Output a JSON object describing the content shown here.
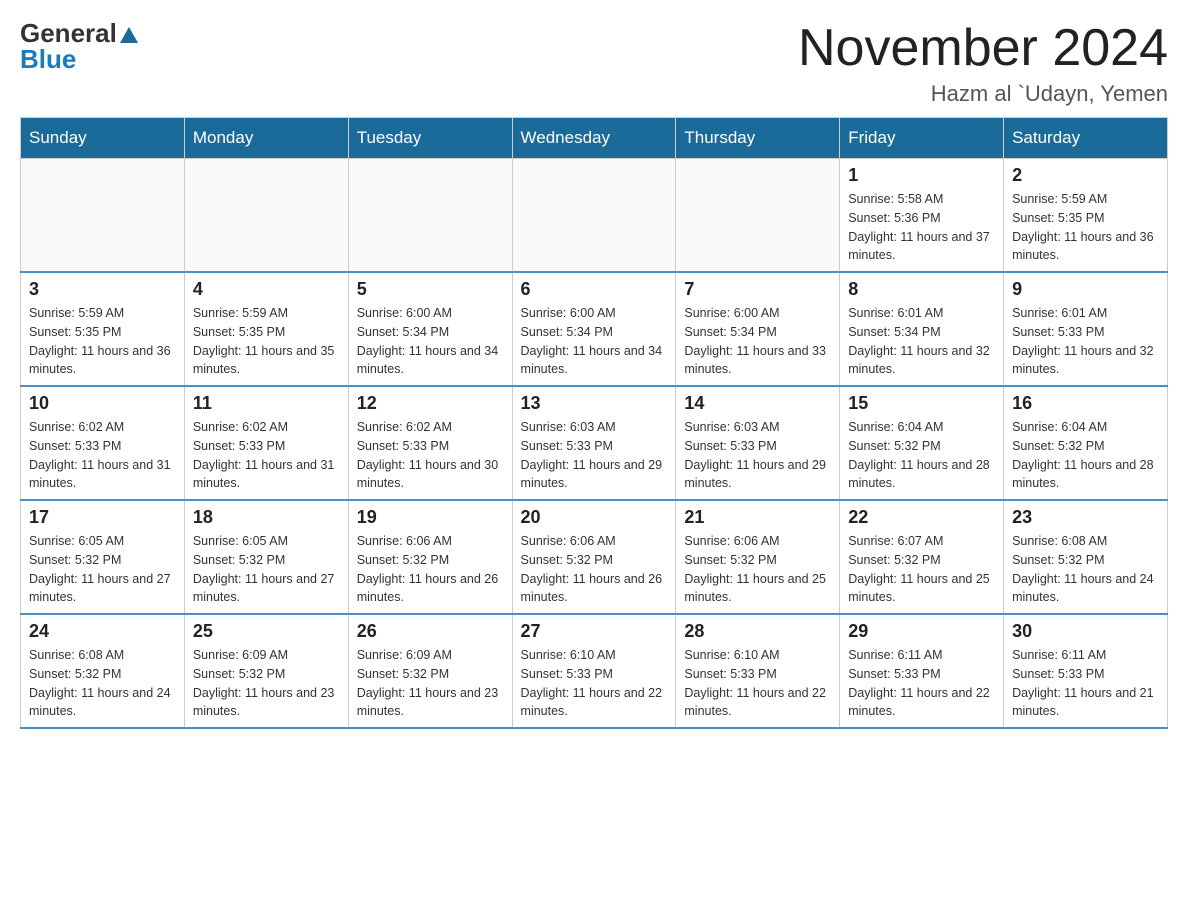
{
  "logo": {
    "general": "General",
    "blue": "Blue"
  },
  "title": "November 2024",
  "location": "Hazm al `Udayn, Yemen",
  "days_of_week": [
    "Sunday",
    "Monday",
    "Tuesday",
    "Wednesday",
    "Thursday",
    "Friday",
    "Saturday"
  ],
  "weeks": [
    [
      {
        "day": "",
        "info": ""
      },
      {
        "day": "",
        "info": ""
      },
      {
        "day": "",
        "info": ""
      },
      {
        "day": "",
        "info": ""
      },
      {
        "day": "",
        "info": ""
      },
      {
        "day": "1",
        "info": "Sunrise: 5:58 AM\nSunset: 5:36 PM\nDaylight: 11 hours and 37 minutes."
      },
      {
        "day": "2",
        "info": "Sunrise: 5:59 AM\nSunset: 5:35 PM\nDaylight: 11 hours and 36 minutes."
      }
    ],
    [
      {
        "day": "3",
        "info": "Sunrise: 5:59 AM\nSunset: 5:35 PM\nDaylight: 11 hours and 36 minutes."
      },
      {
        "day": "4",
        "info": "Sunrise: 5:59 AM\nSunset: 5:35 PM\nDaylight: 11 hours and 35 minutes."
      },
      {
        "day": "5",
        "info": "Sunrise: 6:00 AM\nSunset: 5:34 PM\nDaylight: 11 hours and 34 minutes."
      },
      {
        "day": "6",
        "info": "Sunrise: 6:00 AM\nSunset: 5:34 PM\nDaylight: 11 hours and 34 minutes."
      },
      {
        "day": "7",
        "info": "Sunrise: 6:00 AM\nSunset: 5:34 PM\nDaylight: 11 hours and 33 minutes."
      },
      {
        "day": "8",
        "info": "Sunrise: 6:01 AM\nSunset: 5:34 PM\nDaylight: 11 hours and 32 minutes."
      },
      {
        "day": "9",
        "info": "Sunrise: 6:01 AM\nSunset: 5:33 PM\nDaylight: 11 hours and 32 minutes."
      }
    ],
    [
      {
        "day": "10",
        "info": "Sunrise: 6:02 AM\nSunset: 5:33 PM\nDaylight: 11 hours and 31 minutes."
      },
      {
        "day": "11",
        "info": "Sunrise: 6:02 AM\nSunset: 5:33 PM\nDaylight: 11 hours and 31 minutes."
      },
      {
        "day": "12",
        "info": "Sunrise: 6:02 AM\nSunset: 5:33 PM\nDaylight: 11 hours and 30 minutes."
      },
      {
        "day": "13",
        "info": "Sunrise: 6:03 AM\nSunset: 5:33 PM\nDaylight: 11 hours and 29 minutes."
      },
      {
        "day": "14",
        "info": "Sunrise: 6:03 AM\nSunset: 5:33 PM\nDaylight: 11 hours and 29 minutes."
      },
      {
        "day": "15",
        "info": "Sunrise: 6:04 AM\nSunset: 5:32 PM\nDaylight: 11 hours and 28 minutes."
      },
      {
        "day": "16",
        "info": "Sunrise: 6:04 AM\nSunset: 5:32 PM\nDaylight: 11 hours and 28 minutes."
      }
    ],
    [
      {
        "day": "17",
        "info": "Sunrise: 6:05 AM\nSunset: 5:32 PM\nDaylight: 11 hours and 27 minutes."
      },
      {
        "day": "18",
        "info": "Sunrise: 6:05 AM\nSunset: 5:32 PM\nDaylight: 11 hours and 27 minutes."
      },
      {
        "day": "19",
        "info": "Sunrise: 6:06 AM\nSunset: 5:32 PM\nDaylight: 11 hours and 26 minutes."
      },
      {
        "day": "20",
        "info": "Sunrise: 6:06 AM\nSunset: 5:32 PM\nDaylight: 11 hours and 26 minutes."
      },
      {
        "day": "21",
        "info": "Sunrise: 6:06 AM\nSunset: 5:32 PM\nDaylight: 11 hours and 25 minutes."
      },
      {
        "day": "22",
        "info": "Sunrise: 6:07 AM\nSunset: 5:32 PM\nDaylight: 11 hours and 25 minutes."
      },
      {
        "day": "23",
        "info": "Sunrise: 6:08 AM\nSunset: 5:32 PM\nDaylight: 11 hours and 24 minutes."
      }
    ],
    [
      {
        "day": "24",
        "info": "Sunrise: 6:08 AM\nSunset: 5:32 PM\nDaylight: 11 hours and 24 minutes."
      },
      {
        "day": "25",
        "info": "Sunrise: 6:09 AM\nSunset: 5:32 PM\nDaylight: 11 hours and 23 minutes."
      },
      {
        "day": "26",
        "info": "Sunrise: 6:09 AM\nSunset: 5:32 PM\nDaylight: 11 hours and 23 minutes."
      },
      {
        "day": "27",
        "info": "Sunrise: 6:10 AM\nSunset: 5:33 PM\nDaylight: 11 hours and 22 minutes."
      },
      {
        "day": "28",
        "info": "Sunrise: 6:10 AM\nSunset: 5:33 PM\nDaylight: 11 hours and 22 minutes."
      },
      {
        "day": "29",
        "info": "Sunrise: 6:11 AM\nSunset: 5:33 PM\nDaylight: 11 hours and 22 minutes."
      },
      {
        "day": "30",
        "info": "Sunrise: 6:11 AM\nSunset: 5:33 PM\nDaylight: 11 hours and 21 minutes."
      }
    ]
  ]
}
